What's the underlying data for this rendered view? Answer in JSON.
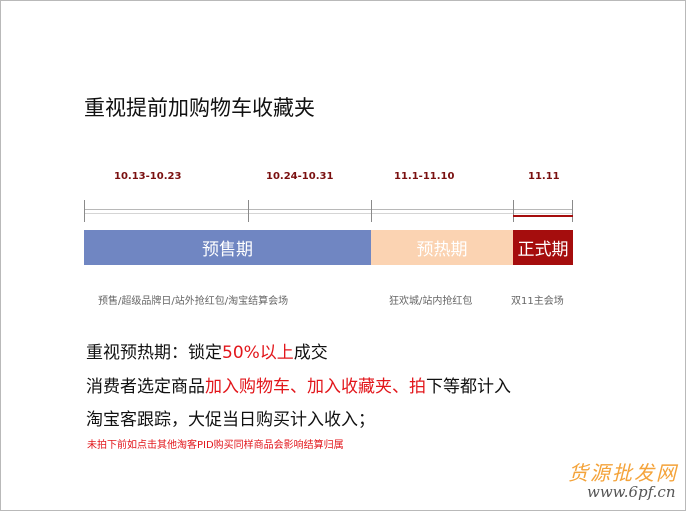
{
  "title": "重视提前加购物车收藏夹",
  "timeline": {
    "dates": [
      "10.13-10.23",
      "10.24-10.31",
      "11.1-11.10",
      "11.11"
    ],
    "phases": [
      {
        "label": "预售期",
        "color": "#7086c2"
      },
      {
        "label": "预热期",
        "color": "#fbd3b2"
      },
      {
        "label": "正式期",
        "color": "#a50d0d"
      }
    ],
    "activities": [
      "预售/超级品牌日/站外抢红包/淘宝结算会场",
      "狂欢城/站内抢红包",
      "双11主会场"
    ]
  },
  "body": {
    "line1_pre": "重视预热期：锁定",
    "line1_hl": "50%以上",
    "line1_post": "成交",
    "line2_pre": "消费者选定商品",
    "line2_hl": "加入购物车、加入收藏夹、拍",
    "line2_post": "下等都计入",
    "line3": "淘宝客跟踪，大促当日购买计入收入；",
    "note": "未拍下前如点击其他淘客PID购买同样商品会影响结算归属"
  },
  "watermark": {
    "cn": "货源批发网",
    "url": "www.6pf.cn"
  }
}
